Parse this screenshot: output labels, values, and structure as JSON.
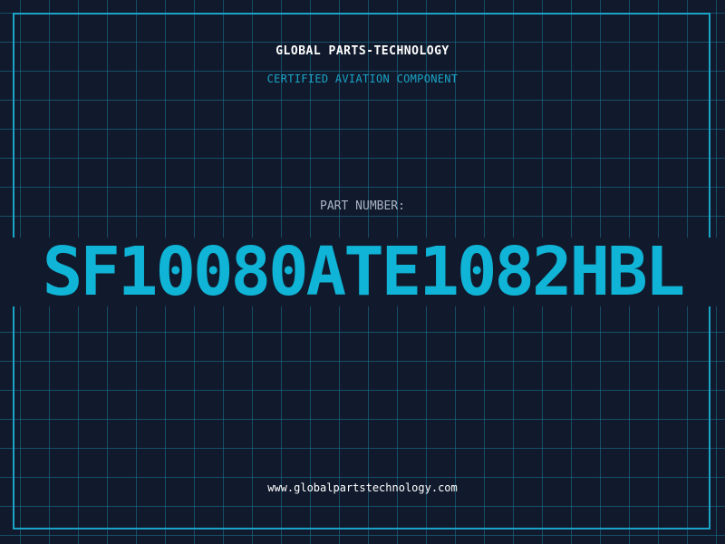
{
  "header": {
    "company_name": "GLOBAL PARTS-TECHNOLOGY",
    "subtitle": "CERTIFIED AVIATION COMPONENT"
  },
  "part": {
    "label": "PART NUMBER:",
    "number": "SF10080ATE1082HBL"
  },
  "footer": {
    "website": "www.globalpartstechnology.com"
  },
  "colors": {
    "background": "#111a2c",
    "grid": "#1a7896",
    "accent": "#1aa3c6",
    "part_number": "#0fb4d6",
    "text_primary": "#ffffff",
    "text_muted": "#a8b4c4"
  }
}
